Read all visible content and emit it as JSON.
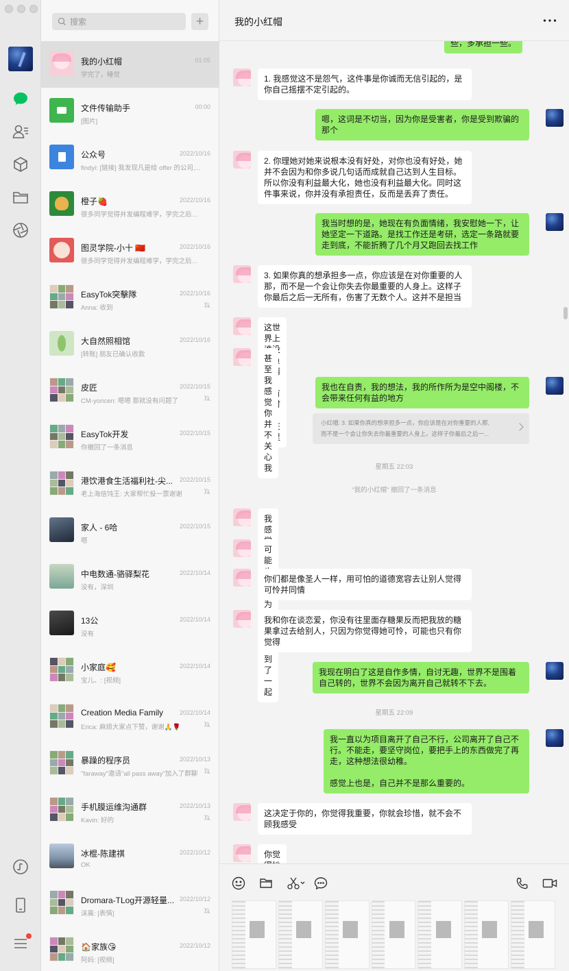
{
  "window": {
    "traffic_lights": [
      "close",
      "minimize",
      "zoom"
    ]
  },
  "sidebar": {
    "icons": [
      "user-avatar",
      "chat-icon",
      "contacts-icon",
      "favorites-cube-icon",
      "files-folder-icon",
      "moments-aperture-icon",
      "mini-programs-icon",
      "phone-device-icon",
      "menu-icon"
    ],
    "accent_color": "#07c160",
    "badge_color": "#f2453d"
  },
  "search": {
    "placeholder": "搜索",
    "add_label": "+"
  },
  "conversations": [
    {
      "name": "我的小红帽",
      "time": "01:05",
      "preview": "学完了，睡觉",
      "active": true,
      "muted": false
    },
    {
      "name": "文件传输助手",
      "time": "00:00",
      "preview": "[图片]",
      "muted": false
    },
    {
      "name": "公众号",
      "time": "2022/10/16",
      "preview": "findyi: [链接] 我发现凡是给 offer 的公司,...",
      "muted": false
    },
    {
      "name": "橙子🍓",
      "time": "2022/10/16",
      "preview": "很多同学觉得并发编程难学，学完之后工作...",
      "muted": false
    },
    {
      "name": "图灵学院-小十 🇨🇳",
      "time": "2022/10/16",
      "preview": "很多同学觉得并发编程难学，学完之后工作...",
      "muted": false
    },
    {
      "name": "EasyTok突擊隊",
      "time": "2022/10/16",
      "preview": "Anna: 收到",
      "muted": true
    },
    {
      "name": "大自然照相馆",
      "time": "2022/10/16",
      "preview": "[转账] 朋友已确认收款",
      "muted": false
    },
    {
      "name": "皮匠",
      "time": "2022/10/15",
      "preview": "CM-yoricen: 嗯嗯  那就没有问题了",
      "muted": true
    },
    {
      "name": "EasyTok开发",
      "time": "2022/10/15",
      "preview": "你撤回了一条消息",
      "muted": false
    },
    {
      "name": "港饮港食生活福利社-尖...",
      "time": "2022/10/15",
      "preview": "老上海信饨王: 大家帮忙投一票谢谢",
      "muted": true
    },
    {
      "name": "家人 - 6哈",
      "time": "2022/10/15",
      "preview": "嗯",
      "muted": false
    },
    {
      "name": "中电数通-骆驿梨花",
      "time": "2022/10/14",
      "preview": "没有，深圳",
      "muted": false
    },
    {
      "name": "13公",
      "time": "2022/10/14",
      "preview": "没有",
      "muted": false
    },
    {
      "name": "小家庭🥰",
      "time": "2022/10/14",
      "preview": "宝儿、: [视频]",
      "muted": false
    },
    {
      "name": "Creation Media Family",
      "time": "2022/10/14",
      "preview": "Erica: 麻烦大家点下赞，谢谢🙏🌹",
      "muted": true
    },
    {
      "name": "暴躁的程序员",
      "time": "2022/10/13",
      "preview": "\"faraway\"邀请\"all pass away\"加入了群聊",
      "muted": true
    },
    {
      "name": "手机膜运维沟通群",
      "time": "2022/10/13",
      "preview": "Kavin: 好的",
      "muted": true
    },
    {
      "name": "冰棍-陈建祺",
      "time": "2022/10/12",
      "preview": "OK",
      "muted": false
    },
    {
      "name": "Dromara-TLog开源轻量...",
      "time": "2022/10/12",
      "preview": "沫离: [表情]",
      "muted": true
    },
    {
      "name": "🏠家族😘",
      "time": "2022/10/12",
      "preview": "阿妈: [视频]",
      "muted": false
    }
  ],
  "chat": {
    "title": "我的小红帽",
    "more_label": "•••",
    "messages": [
      {
        "side": "right",
        "text": "些，多承担一些。"
      },
      {
        "side": "left",
        "text": "1. 我感觉这不是怨气，这件事是你诚而无信引起的，是\n你自己摇摆不定引起的。"
      },
      {
        "side": "right",
        "text": "嗯，这词是不切当，因为你是受害者，你是受到欺骗的\n那个"
      },
      {
        "side": "left",
        "text": "2. 你理她对她来说根本没有好处，对你也没有好处，她\n并不会因为和你多说几句话而成就自己达到人生目标。\n所以你没有利益最大化，她也没有利益最大化。同时这\n件事来说，你并没有承担责任，反而是丢弃了责任。"
      },
      {
        "side": "right",
        "text": "我当时想的是，她现在有负面情绪，我安慰她一下，让\n她坚定一下道路。是找工作还是考研，选定一条路就要\n走到底，不能折腾了几个月又跑回去找工作"
      },
      {
        "side": "left",
        "text": "3. 如果你真的想承担多一点，你应该是在对你重要的人\n那，而不是一个会让你失去你最重要的人身上。这样子\n你最后之后一无所有，伤害了无数个人。这并不是担当"
      },
      {
        "side": "left",
        "text": "这世界上谁没有负面情绪，我有的时候，你在哪里"
      },
      {
        "side": "left",
        "text": "甚至我感觉你并不关心我"
      },
      {
        "side": "right",
        "text": "我也在自责，我的想法，我的所作所为是空中阁楼，不\n会带来任何有益的地方"
      },
      {
        "side": "left",
        "text": "我感觉你们是真的相似的"
      },
      {
        "side": "left",
        "text": "可能也是因为相似才走到了一起"
      },
      {
        "side": "left",
        "text": "你们都是像圣人一样，用可怕的道德宽容去让别人觉得\n可怜并同情"
      },
      {
        "side": "left",
        "text": "我和你在谈恋爱，你没有往里面存糖果反而把我放的糖\n果拿过去给别人，只因为你觉得她可怜，可能也只有你\n觉得"
      },
      {
        "side": "right",
        "text": "我现在明白了这是自作多情，自讨无趣，世界不是围着\n自己转的，世界不会因为离开自己就转不下去。"
      },
      {
        "side": "right",
        "text": "我一直以为项目离开了自己不行，公司离开了自己不\n行。不能走，要坚守岗位，要把手上的东西做完了再\n走，这种想法很幼稚。\n\n感觉上也是，自己并不是那么重要的。"
      },
      {
        "side": "left",
        "text": "这决定于你的，你觉得我重要，你就会珍惜，就不会不\n顾我感受"
      },
      {
        "side": "left",
        "text": "你觉得她重要，你也会这样"
      }
    ],
    "quote": {
      "line1": "小红帽: 3. 如果你真的想承担多一点，你应该是在对你重要的人那,",
      "line2": "而不是一个会让你失去你最重要的人身上。这样子你最后之后一..."
    },
    "system": {
      "time1": "星期五 22:03",
      "recall": "\"我的小红帽\" 撤回了一条消息",
      "time2": "星期五 22:09"
    }
  },
  "toolbar": {
    "tools_left": [
      "emoji-icon",
      "folder-icon",
      "scissors-icon",
      "chat-history-icon"
    ],
    "tools_right": [
      "voice-call-icon",
      "video-call-icon"
    ]
  }
}
